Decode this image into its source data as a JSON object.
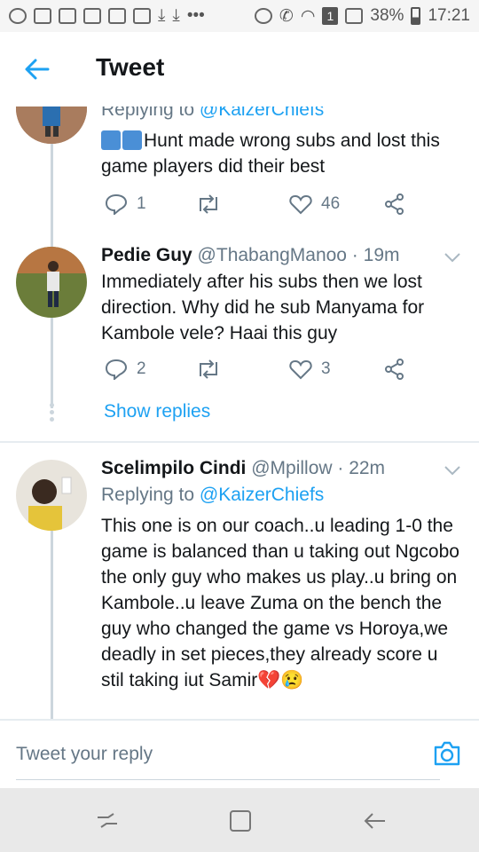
{
  "status": {
    "battery": "38%",
    "time": "17:21",
    "badge": "1"
  },
  "header": {
    "title": "Tweet"
  },
  "tweets": [
    {
      "replying_prefix": "Replying to",
      "replying_handle": "@KaizerChiefs",
      "text": "Hunt made wrong subs and lost this game players did their best",
      "replies": "1",
      "likes": "46"
    },
    {
      "name": "Pedie Guy",
      "handle_time": "@ThabangManoo · 19m",
      "text": "Immediately after his subs then we lost direction. Why did he sub Manyama for Kambole vele? Haai this guy",
      "replies": "2",
      "likes": "3",
      "show_replies": "Show replies"
    },
    {
      "name": "Scelimpilo  Cindi",
      "handle_time": "@Mpillow · 22m",
      "replying_prefix": "Replying to",
      "replying_handle": "@KaizerChiefs",
      "text": "This one is on our coach..u leading 1-0 the game is balanced than u taking out Ngcobo the only guy who makes us play..u bring on Kambole..u leave Zuma on the bench the guy who changed the game vs Horoya,we deadly in set pieces,they already score u stil taking iut Samir💔😢"
    }
  ],
  "reply_bar": {
    "placeholder": "Tweet your reply"
  },
  "colors": {
    "accent": "#1da1f2",
    "muted": "#657786",
    "text": "#14171a"
  }
}
